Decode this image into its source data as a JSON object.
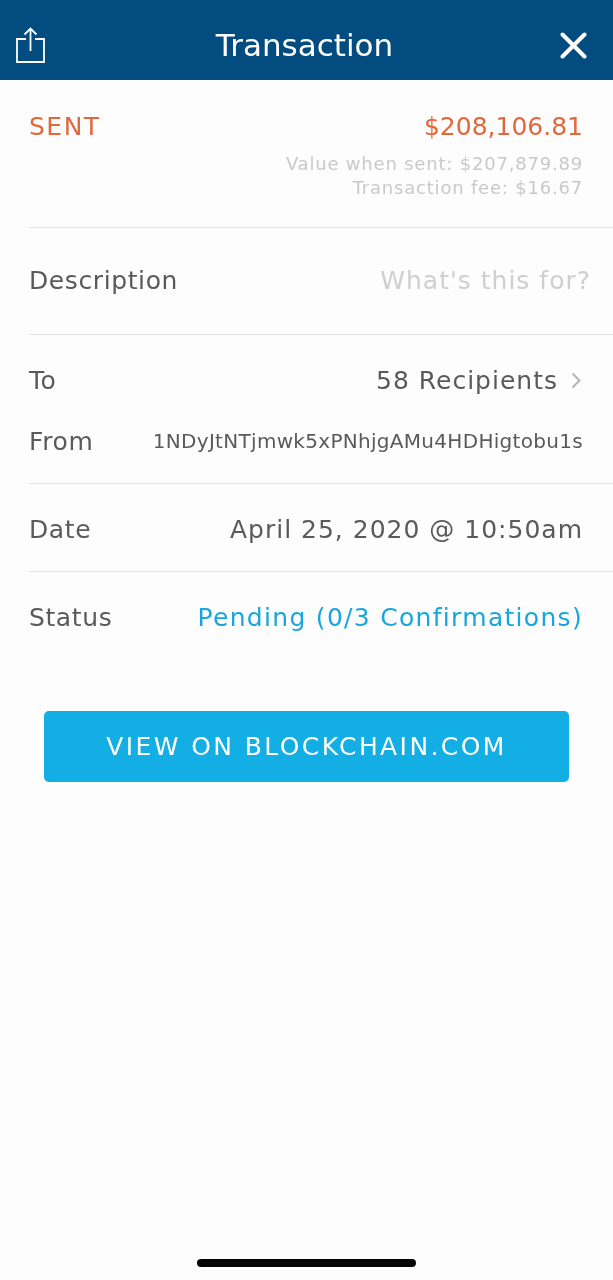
{
  "header": {
    "title": "Transaction"
  },
  "summary": {
    "direction": "SENT",
    "amount": "$208,106.81",
    "value_when_sent": "Value when sent: $207,879.89",
    "fee": "Transaction fee: $16.67"
  },
  "details": [
    {
      "rows": [
        {
          "kind": "input",
          "label": "Description",
          "placeholder": "What's this for?"
        }
      ]
    },
    {
      "rows": [
        {
          "kind": "link",
          "label": "To",
          "value": "58 Recipients"
        },
        {
          "kind": "address",
          "label": "From",
          "value": "1NDyJtNTjmwk5xPNhjgAMu4HDHigtobu1s"
        }
      ]
    },
    {
      "rows": [
        {
          "kind": "text",
          "label": "Date",
          "value": "April 25, 2020 @ 10:50am"
        }
      ]
    },
    {
      "rows": [
        {
          "kind": "status",
          "label": "Status",
          "value": "Pending (0/3 Confirmations)"
        }
      ]
    }
  ],
  "action_button": {
    "label": "VIEW ON BLOCKCHAIN.COM"
  }
}
